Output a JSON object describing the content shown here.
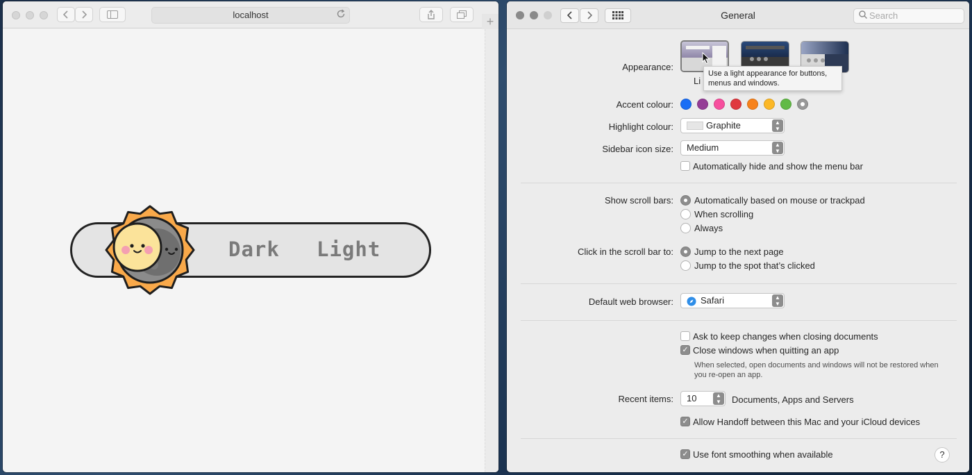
{
  "safari": {
    "url": "localhost",
    "toggle": {
      "dark_label": "Dark",
      "light_label": "Light"
    },
    "new_tab_label": "+"
  },
  "prefs": {
    "title": "General",
    "search_placeholder": "Search",
    "appearance": {
      "label": "Appearance:",
      "selected_caption": "Li",
      "tooltip": "Use a light appearance for buttons, menus and windows."
    },
    "accent": {
      "label": "Accent colour:",
      "colors": [
        "#1a6ef5",
        "#953d96",
        "#f74f9e",
        "#e0383e",
        "#f7821b",
        "#fcb827",
        "#62ba46",
        "#989898"
      ]
    },
    "highlight": {
      "label": "Highlight colour:",
      "value": "Graphite"
    },
    "sidebar": {
      "label": "Sidebar icon size:",
      "value": "Medium"
    },
    "menubar_autohide": {
      "label": "Automatically hide and show the menu bar",
      "checked": false
    },
    "scrollbars": {
      "label": "Show scroll bars:",
      "options": [
        "Automatically based on mouse or trackpad",
        "When scrolling",
        "Always"
      ],
      "selected": 0
    },
    "scroll_click": {
      "label": "Click in the scroll bar to:",
      "options": [
        "Jump to the next page",
        "Jump to the spot that’s clicked"
      ],
      "selected": 0
    },
    "browser": {
      "label": "Default web browser:",
      "value": "Safari"
    },
    "ask_keep_changes": {
      "label": "Ask to keep changes when closing documents",
      "checked": false
    },
    "close_windows": {
      "label": "Close windows when quitting an app",
      "checked": true,
      "note": "When selected, open documents and windows will not be restored when you re-open an app."
    },
    "recent_items": {
      "label": "Recent items:",
      "value": "10",
      "suffix": "Documents, Apps and Servers"
    },
    "handoff": {
      "label": "Allow Handoff between this Mac and your iCloud devices",
      "checked": true
    },
    "font_smoothing": {
      "label": "Use font smoothing when available",
      "checked": true
    },
    "help_label": "?"
  }
}
